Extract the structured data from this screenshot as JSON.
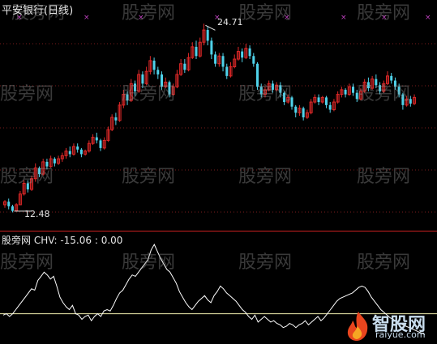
{
  "main_title": "平安银行(日线)",
  "watermark_text": "股旁网",
  "high_label": "24.71",
  "low_label": "12.48",
  "indicator": {
    "name": "股旁网",
    "text": "CHV: -15.06 : 0.00"
  },
  "logo": {
    "main": "智股网",
    "sub": "raiyue.com"
  },
  "colors": {
    "up": "#e02828",
    "down": "#4fd2ea",
    "line": "#ffffff",
    "zero_line": "#f3f0b0",
    "separator": "#cc2020",
    "marker": "#c040c0"
  },
  "chart_data": [
    {
      "type": "candlestick",
      "title": "平安银行(日线)",
      "price_labels": {
        "high": 24.71,
        "low": 12.48
      },
      "candles": [
        [
          12.9,
          13.1,
          12.7,
          13.2
        ],
        [
          13.1,
          12.8,
          12.6,
          13.3
        ],
        [
          12.8,
          12.5,
          12.4,
          12.9
        ],
        [
          12.5,
          12.9,
          12.5,
          13.0
        ],
        [
          12.9,
          13.6,
          12.9,
          13.8
        ],
        [
          13.6,
          14.3,
          13.5,
          14.5
        ],
        [
          14.3,
          13.9,
          13.7,
          14.5
        ],
        [
          13.9,
          14.6,
          13.8,
          14.8
        ],
        [
          14.6,
          15.3,
          14.4,
          15.6
        ],
        [
          15.3,
          14.9,
          14.7,
          15.4
        ],
        [
          14.9,
          15.7,
          14.8,
          15.9
        ],
        [
          15.7,
          15.4,
          15.2,
          15.9
        ],
        [
          15.4,
          15.9,
          15.3,
          16.1
        ],
        [
          15.9,
          15.6,
          15.4,
          16.0
        ],
        [
          15.6,
          15.9,
          15.5,
          16.1
        ],
        [
          15.9,
          16.1,
          15.7,
          16.3
        ],
        [
          16.1,
          16.4,
          15.9,
          16.6
        ],
        [
          16.4,
          16.2,
          16.0,
          16.7
        ],
        [
          16.2,
          16.7,
          16.1,
          16.9
        ],
        [
          16.7,
          16.5,
          16.3,
          16.9
        ],
        [
          16.5,
          16.2,
          16.0,
          16.6
        ],
        [
          16.2,
          16.4,
          16.1,
          16.5
        ],
        [
          16.4,
          16.9,
          16.3,
          17.1
        ],
        [
          16.9,
          17.3,
          16.8,
          17.5
        ],
        [
          17.3,
          17.1,
          16.9,
          17.6
        ],
        [
          17.1,
          16.6,
          16.4,
          17.2
        ],
        [
          16.6,
          17.1,
          16.5,
          17.3
        ],
        [
          17.1,
          17.8,
          17.0,
          18.0
        ],
        [
          17.8,
          18.6,
          17.7,
          18.8
        ],
        [
          18.6,
          18.4,
          18.1,
          18.9
        ],
        [
          18.4,
          19.4,
          18.3,
          19.6
        ],
        [
          19.4,
          20.1,
          19.2,
          20.4
        ],
        [
          20.1,
          19.7,
          19.4,
          20.3
        ],
        [
          19.7,
          20.8,
          19.6,
          21.1
        ],
        [
          20.8,
          20.3,
          20.0,
          21.0
        ],
        [
          20.3,
          21.4,
          20.2,
          21.7
        ],
        [
          21.4,
          20.8,
          20.5,
          21.6
        ],
        [
          20.8,
          21.6,
          20.7,
          21.9
        ],
        [
          21.6,
          22.3,
          21.4,
          22.6
        ],
        [
          22.3,
          21.7,
          21.4,
          22.5
        ],
        [
          21.7,
          21.4,
          21.1,
          21.9
        ],
        [
          21.4,
          20.6,
          20.4,
          21.6
        ],
        [
          20.6,
          20.9,
          20.5,
          21.2
        ],
        [
          20.9,
          20.1,
          19.9,
          21.0
        ],
        [
          20.1,
          20.6,
          20.0,
          20.8
        ],
        [
          20.6,
          21.4,
          20.5,
          21.7
        ],
        [
          21.4,
          22.1,
          21.3,
          22.4
        ],
        [
          22.1,
          21.7,
          21.5,
          22.4
        ],
        [
          21.7,
          22.5,
          21.6,
          22.8
        ],
        [
          22.5,
          23.2,
          22.4,
          23.5
        ],
        [
          23.2,
          22.6,
          22.4,
          23.6
        ],
        [
          22.6,
          23.5,
          22.5,
          23.8
        ],
        [
          23.5,
          24.3,
          23.3,
          24.71
        ],
        [
          24.3,
          23.6,
          23.3,
          24.5
        ],
        [
          23.6,
          22.7,
          22.4,
          23.8
        ],
        [
          22.7,
          22.1,
          21.9,
          22.9
        ],
        [
          22.1,
          22.6,
          21.9,
          22.8
        ],
        [
          22.6,
          21.9,
          21.6,
          22.8
        ],
        [
          21.9,
          21.3,
          21.1,
          22.1
        ],
        [
          21.3,
          21.9,
          21.2,
          22.2
        ],
        [
          21.9,
          22.4,
          21.8,
          22.7
        ],
        [
          22.4,
          22.9,
          22.3,
          23.2
        ],
        [
          22.9,
          22.5,
          22.2,
          23.1
        ],
        [
          22.5,
          23.1,
          22.4,
          23.4
        ],
        [
          23.1,
          22.6,
          22.4,
          23.3
        ],
        [
          22.6,
          22.1,
          21.9,
          22.8
        ],
        [
          22.1,
          20.6,
          20.4,
          22.2
        ],
        [
          20.6,
          20.1,
          19.9,
          20.8
        ],
        [
          20.1,
          20.4,
          19.9,
          20.6
        ],
        [
          20.4,
          20.8,
          20.3,
          21.0
        ],
        [
          20.8,
          20.4,
          20.2,
          21.0
        ],
        [
          20.4,
          20.7,
          20.3,
          20.9
        ],
        [
          20.7,
          20.2,
          19.9,
          20.9
        ],
        [
          20.2,
          19.6,
          19.4,
          20.3
        ],
        [
          19.6,
          19.9,
          19.5,
          20.1
        ],
        [
          19.9,
          19.3,
          19.1,
          20.0
        ],
        [
          19.3,
          18.9,
          18.6,
          19.4
        ],
        [
          18.9,
          19.2,
          18.7,
          19.4
        ],
        [
          19.2,
          18.6,
          18.4,
          19.3
        ],
        [
          18.6,
          18.9,
          18.5,
          19.1
        ],
        [
          18.9,
          19.6,
          18.8,
          19.8
        ],
        [
          19.6,
          19.9,
          19.5,
          20.1
        ],
        [
          19.9,
          19.6,
          19.4,
          20.1
        ],
        [
          19.6,
          19.9,
          19.5,
          20.0
        ],
        [
          19.9,
          19.4,
          19.2,
          20.0
        ],
        [
          19.4,
          19.1,
          18.9,
          19.6
        ],
        [
          19.1,
          19.6,
          19.0,
          19.8
        ],
        [
          19.6,
          20.1,
          19.5,
          20.3
        ],
        [
          20.1,
          20.4,
          19.9,
          20.6
        ],
        [
          20.4,
          20.1,
          19.9,
          20.5
        ],
        [
          20.1,
          20.6,
          20.0,
          20.8
        ],
        [
          20.6,
          20.2,
          20.0,
          20.8
        ],
        [
          20.2,
          19.8,
          19.6,
          20.4
        ],
        [
          19.8,
          20.3,
          19.7,
          20.5
        ],
        [
          20.3,
          20.9,
          20.2,
          21.1
        ],
        [
          20.9,
          20.5,
          20.3,
          21.2
        ],
        [
          20.5,
          21.1,
          20.4,
          21.3
        ],
        [
          21.1,
          20.7,
          20.5,
          21.4
        ],
        [
          20.7,
          20.3,
          20.1,
          20.9
        ],
        [
          20.3,
          20.8,
          20.2,
          21.0
        ],
        [
          20.8,
          21.3,
          20.7,
          21.6
        ],
        [
          21.3,
          21.0,
          20.8,
          21.5
        ],
        [
          21.0,
          20.6,
          20.4,
          21.2
        ],
        [
          20.6,
          20.1,
          19.9,
          20.8
        ],
        [
          20.1,
          19.4,
          19.1,
          20.2
        ],
        [
          19.4,
          19.8,
          19.3,
          20.0
        ],
        [
          19.8,
          19.5,
          19.3,
          20.0
        ],
        [
          19.5,
          19.9,
          19.4,
          20.1
        ]
      ]
    },
    {
      "type": "line",
      "title": "CHV",
      "series": [
        {
          "name": "CHV",
          "values": [
            -1,
            0,
            -2,
            0,
            3,
            6,
            9,
            12,
            15,
            18,
            17,
            24,
            27,
            30,
            28,
            25,
            27,
            20,
            12,
            8,
            5,
            3,
            6,
            0,
            -1,
            -4,
            -2,
            -1,
            -5,
            -2,
            0,
            -2,
            2,
            3,
            2,
            6,
            11,
            15,
            17,
            21,
            25,
            28,
            27,
            30,
            33,
            36,
            39,
            46,
            50,
            45,
            40,
            36,
            32,
            30,
            26,
            22,
            16,
            12,
            8,
            5,
            3,
            6,
            9,
            11,
            13,
            10,
            8,
            13,
            16,
            20,
            18,
            15,
            13,
            11,
            9,
            6,
            3,
            1,
            -2,
            -4,
            -1,
            -6,
            -4,
            -2,
            -4,
            -6,
            -5,
            -7,
            -8,
            -10,
            -9,
            -7,
            -8,
            -10,
            -8,
            -7,
            -5,
            -8,
            -6,
            -4,
            -2,
            -5,
            -3,
            0,
            3,
            6,
            9,
            11,
            12,
            13,
            14,
            15,
            17,
            19,
            20,
            19,
            16,
            12,
            9,
            6,
            3,
            1,
            -1,
            -3,
            -4,
            -6,
            -7,
            -8,
            -9,
            -10,
            -11,
            -12,
            -13,
            -14,
            -15.06
          ]
        },
        {
          "name": "zero",
          "values": [
            0
          ]
        }
      ],
      "values_text": "CHV: -15.06 : 0.00"
    }
  ]
}
